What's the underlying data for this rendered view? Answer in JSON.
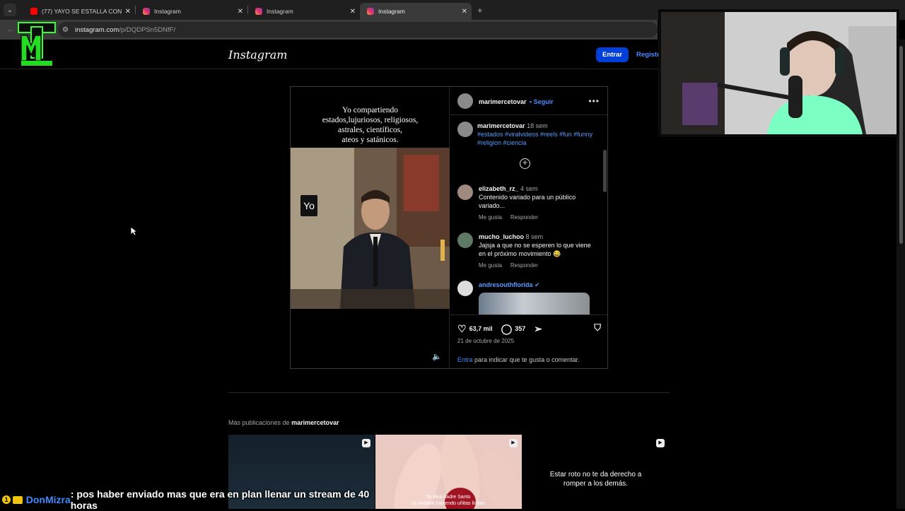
{
  "browser": {
    "tabs": [
      {
        "title": "(77) YAYO SE ESTALLA CON LO...",
        "favicon": "youtube-icon"
      },
      {
        "title": "Instagram",
        "favicon": "instagram-icon"
      },
      {
        "title": "Instagram",
        "favicon": "instagram-icon"
      },
      {
        "title": "Instagram",
        "favicon": "instagram-icon"
      }
    ],
    "active_tab": 3,
    "url_domain": "instagram.com",
    "url_path": "/p/DQDPSn5DNfF/"
  },
  "header": {
    "wordmark": "Instagram",
    "login_label": "Entrar",
    "register_label": "Registra"
  },
  "post": {
    "media_caption": "Yo compartiendo\nestados,lujuriosos, religiosos,\nastrales, científicos,\nateos y satánicos.",
    "media_label": "Yo",
    "author": "marimercetovar",
    "follow_label": "Seguir",
    "caption": {
      "user": "marimercetovar",
      "time": "18 sem",
      "tags": "#estados #viralvideos #reels #fun #funny #religion #ciencia"
    },
    "comments": [
      {
        "user": "elizabeth_rz_",
        "time": "4 sem",
        "text": "Contenido variado para un público variado...",
        "like": "Me gusta",
        "reply": "Responder"
      },
      {
        "user": "mucho_luchoo",
        "time": "8 sem",
        "text": "Jajsja a que no se esperen lo que viene en el próximo movimiento 😂",
        "like": "Me gusta",
        "reply": "Responder"
      },
      {
        "user": "andresouthflorida",
        "time": "",
        "text": "",
        "like": "",
        "reply": ""
      }
    ],
    "likes": "63,7 mil",
    "comment_count": "357",
    "date": "21 de octubre de 2025",
    "login_link": "Entra",
    "login_text": " para indicar que te gusta o comentar."
  },
  "more_posts": {
    "prefix": "Más publicaciones de ",
    "author": "marimercetovar",
    "tile2_text": "Ni idea padre Santo\nYo andaba haciendo uñitas lindas.",
    "tile3_text": "Estar roto no te da derecho a\nromper a los demás."
  },
  "stream_overlay": {
    "badge": "1",
    "chat_user": "DonMizra",
    "chat_message": ": pos haber enviado mas que era en plan llenar un stream de 40 horas"
  },
  "colors": {
    "accent_blue": "#0040d8",
    "link_blue": "#4a8cff",
    "chat_user": "#3d8bff"
  }
}
